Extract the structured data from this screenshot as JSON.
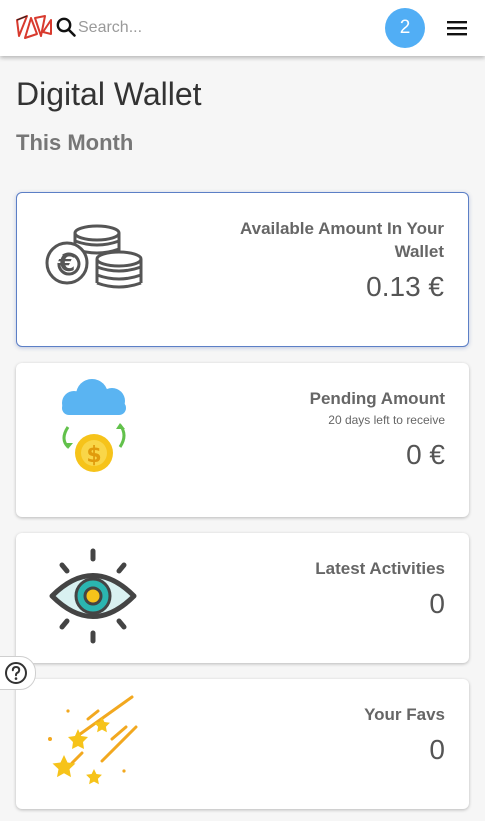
{
  "header": {
    "search_placeholder": "Search...",
    "notification_count": "2"
  },
  "page": {
    "title": "Digital Wallet",
    "section": "This Month"
  },
  "cards": [
    {
      "title": "Available Amount In Your Wallet",
      "value": "0.13 €",
      "icon": "euro-coins-icon"
    },
    {
      "title": "Pending Amount",
      "subtitle": "20 days left to receive",
      "value": "0 €",
      "icon": "cloud-dollar-coin-icon"
    },
    {
      "title": "Latest Activities",
      "value": "0",
      "icon": "eye-icon"
    },
    {
      "title": "Your Favs",
      "value": "0",
      "icon": "shooting-stars-icon"
    }
  ],
  "colors": {
    "badge": "#51aef5",
    "selected_border": "#5c7fc6",
    "cloud": "#5ab4f2",
    "coin": "#f6c31a",
    "eye_iris": "#2bb5b0"
  }
}
